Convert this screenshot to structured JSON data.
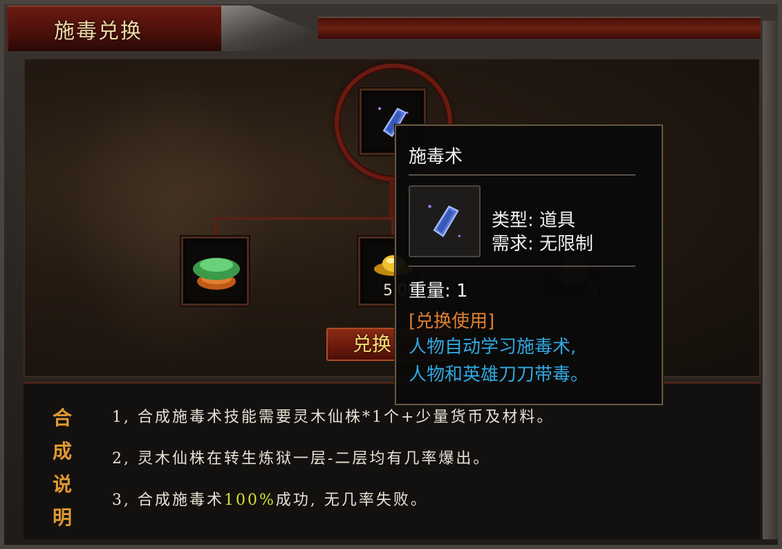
{
  "window": {
    "title": "施毒兑换"
  },
  "slots": {
    "top_item": "book-icon",
    "left_item": "mushroom-icon",
    "mid_item": "gold-ingot-icon",
    "mid_count": "5.00",
    "right_item": "ore-icon",
    "right_count": "5"
  },
  "exchange_button": {
    "label": "兑换"
  },
  "description": {
    "side_label": [
      "合",
      "成",
      "说",
      "明"
    ],
    "lines": [
      "1, 合成施毒术技能需要灵木仙株*1个+少量货币及材料。",
      "2, 灵木仙株在转生炼狱一层-二层均有几率爆出。"
    ],
    "line3_pre": "3, 合成施毒术",
    "line3_highlight": "100%",
    "line3_post": "成功, 无几率失败。"
  },
  "tooltip": {
    "title": "施毒术",
    "type_label": "类型:",
    "type_value": "道具",
    "require_label": "需求:",
    "require_value": "无限制",
    "weight_label": "重量:",
    "weight_value": "1",
    "section": "[兑换使用]",
    "desc_line1": "人物自动学习施毒术,",
    "desc_line2": "人物和英雄刀刀带毒。"
  },
  "colors": {
    "title": "#f0d8a8",
    "accent_orange": "#e09a30",
    "highlight_yellow": "#d8e030",
    "tooltip_section": "#e08030",
    "tooltip_desc": "#30a8e0"
  }
}
